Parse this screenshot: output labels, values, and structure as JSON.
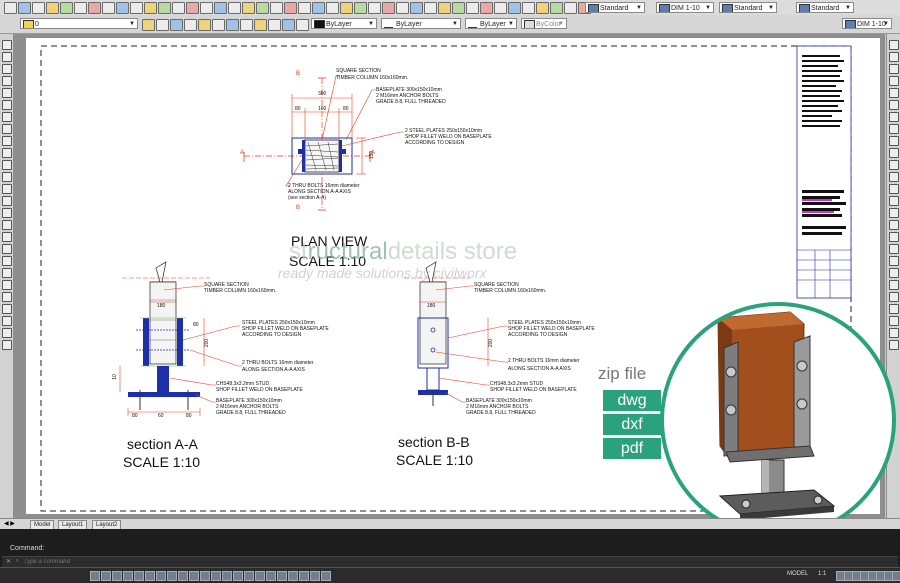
{
  "toolbar": {
    "layer_value": "0",
    "color_value": "ByLayer",
    "linetype_value": "ByLayer",
    "lineweight_value": "ByLayer",
    "plotstyle_value": "ByColor",
    "text_style": "Standard",
    "dim_style": "DIM 1-10",
    "table_style": "Standard",
    "multileader_style": "Standard",
    "dim_style_2": "DIM 1-10"
  },
  "drawing": {
    "plan": {
      "title": "PLAN VIEW",
      "scale": "SCALE 1:10",
      "dims": [
        "300",
        "80",
        "80",
        "100",
        "150"
      ],
      "notes": {
        "square_section": "SQUARE SECTION",
        "timber_column": "TIMBER COLUMN 160x160mm.",
        "baseplate_1": "BASEPLATE 300x150x10mm",
        "baseplate_2": "2 M16mm ANCHOR BOLTS",
        "baseplate_3": "GRADE 8.8, FULL THREADED",
        "plates_1": "2 STEEL PLATES 250x150x10mm",
        "plates_2": "SHOP FILLET WELD ON BASEPLATE",
        "plates_3": "ACCORDING TO DESIGN",
        "bolts_1": "2 THRU BOLTS 16mm diameter",
        "bolts_2": "ALONG SECTION A-A AXIS",
        "bolts_3": "(see section A-A)"
      },
      "marker_a": "A",
      "marker_b": "B"
    },
    "section_aa": {
      "title": "section A-A",
      "scale": "SCALE 1:10",
      "dims": [
        "180",
        "80",
        "200",
        "10",
        "60",
        "80",
        "80"
      ],
      "notes": {
        "square_section": "SQUARE SECTION",
        "timber_column": "TIMBER COLUMN 160x160mm.",
        "plates_1": "STEEL PLATES 250x150x10mm",
        "plates_2": "SHOP FILLET WELD ON BASEPLATE",
        "plates_3": "ACCORDING TO DESIGN",
        "bolts_1": "2 THRU BOLTS 16mm diameter",
        "bolts_2": "ALONG SECTION A-A AXIS",
        "stud_1": "CHS48.3x3.2mm STUD",
        "stud_2": "SHOP FILLET WELD ON BASEPLATE",
        "baseplate_1": "BASEPLATE 300x150x10mm",
        "baseplate_2": "2 M16mm ANCHOR BOLTS",
        "baseplate_3": "GRADE 8.8, FULL THREADED"
      }
    },
    "section_bb": {
      "title": "section B-B",
      "scale": "SCALE 1:10",
      "dims": [
        "180",
        "200"
      ],
      "notes": {
        "square_section": "SQUARE SECTION",
        "timber_column": "TIMBER COLUMN 160x160mm.",
        "plates_1": "STEEL PLATES 250x150x10mm",
        "plates_2": "SHOP FILLET WELD ON BASEPLATE",
        "plates_3": "ACCORDING TO DESIGN",
        "bolts_1": "2 THRU BOLTS 16mm diameter",
        "bolts_2": "ALONG SECTION A-A AXIS",
        "stud_1": "CHS48.3x3.2mm STUD",
        "stud_2": "SHOP FILLET WELD ON BASEPLATE",
        "baseplate_1": "BASEPLATE 300x150x10mm",
        "baseplate_2": "2 M16mm ANCHOR BOLTS",
        "baseplate_3": "GRADE 8.8, FULL THREADED"
      }
    }
  },
  "watermark": {
    "line1_a": "st",
    "line1_b": "ructural",
    "line1_c": "details store",
    "line2": "ready made solutions by civilworx"
  },
  "promo": {
    "zip_label": "zip file",
    "formats": [
      "dwg",
      "dxf",
      "pdf"
    ]
  },
  "tabs": [
    "Model",
    "Layout1",
    "Layout2"
  ],
  "command": {
    "label": "Command:",
    "placeholder": "Type a command"
  },
  "status": {
    "model": "MODEL",
    "scale": "1:1"
  },
  "colors": {
    "accent_green": "#2aa37d",
    "dim_red": "#e8401c",
    "steel_blue": "#1e2fa8"
  }
}
